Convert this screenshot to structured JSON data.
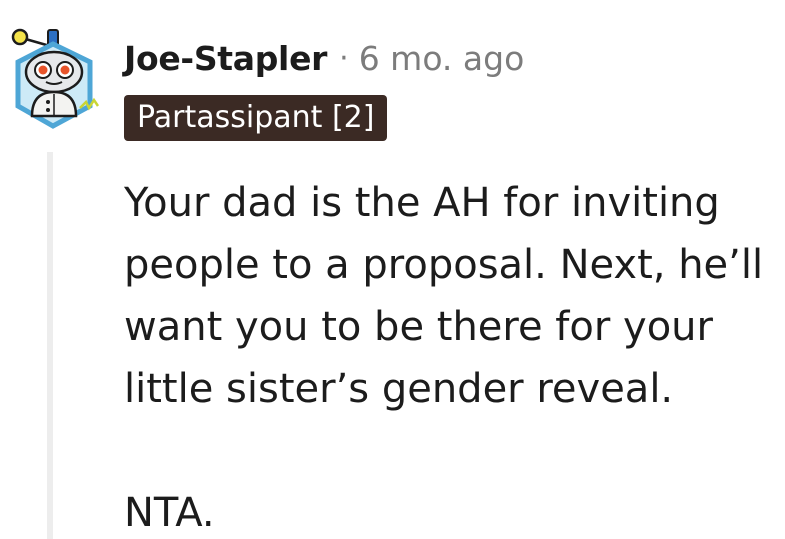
{
  "comment": {
    "username": "Joe-Stapler",
    "separator": "·",
    "timestamp": "6 mo. ago",
    "flair": "Partassipant [2]",
    "avatar_icon": "snoo-robot-avatar-icon",
    "paragraphs": [
      "Your dad is the AH for inviting people to a proposal. Next, he’ll want you to be there for your little sister’s gender reveal.",
      "NTA."
    ]
  },
  "colors": {
    "flair_bg": "#3b2a24",
    "flair_text": "#ffffff",
    "username": "#1c1c1c",
    "meta": "#7c7c7c",
    "thread_line": "#ededed",
    "avatar_ring": "#4ea6d6"
  }
}
